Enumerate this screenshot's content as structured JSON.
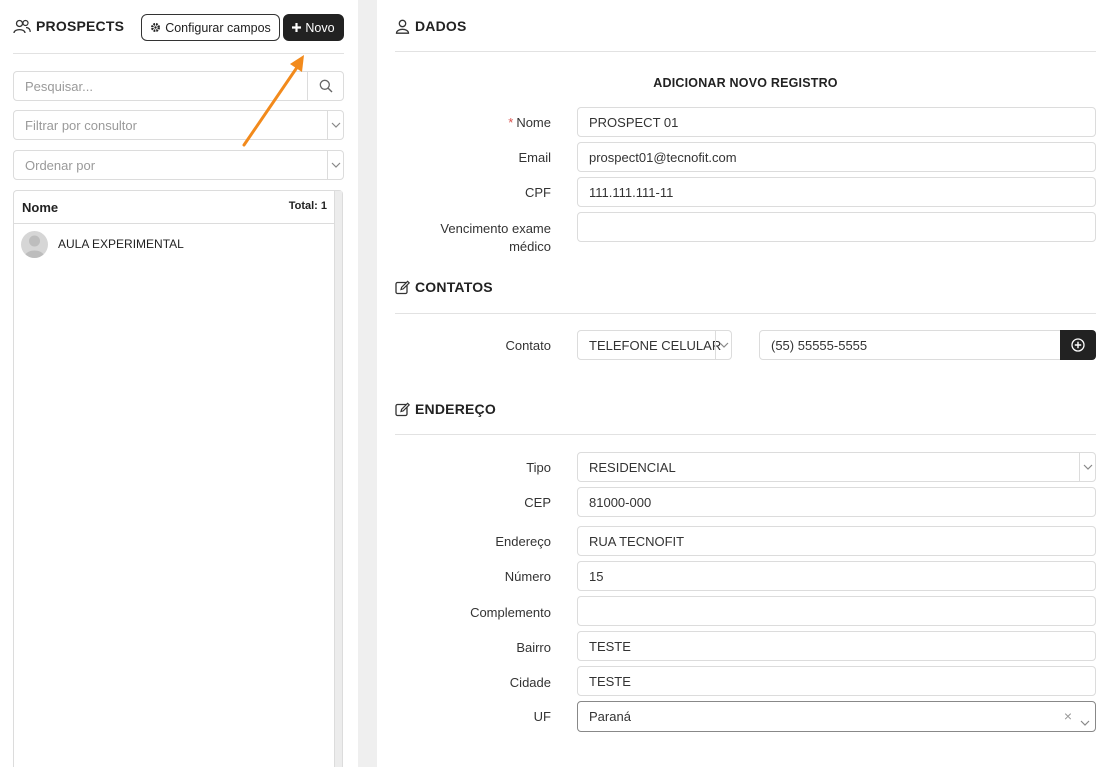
{
  "left": {
    "title": "PROSPECTS",
    "configure_label": "Configurar campos",
    "new_label": "Novo",
    "search": {
      "placeholder": "Pesquisar..."
    },
    "filter": {
      "placeholder": "Filtrar por consultor"
    },
    "order": {
      "placeholder": "Ordenar por"
    },
    "list": {
      "column": "Nome",
      "total": "Total: 1",
      "rows": [
        {
          "name": "AULA EXPERIMENTAL"
        }
      ]
    }
  },
  "right": {
    "dados_title": "DADOS",
    "form_title": "ADICIONAR NOVO REGISTRO",
    "fields": {
      "nome_label": "Nome",
      "nome_value": "PROSPECT 01",
      "email_label": "Email",
      "email_value": "prospect01@tecnofit.com",
      "cpf_label": "CPF",
      "cpf_value": "111.111.111-11",
      "vencimento_label_1": "Vencimento exame",
      "vencimento_label_2": "médico",
      "vencimento_value": ""
    },
    "contatos_title": "CONTATOS",
    "contato": {
      "label": "Contato",
      "type_value": "TELEFONE CELULAR",
      "phone_value": "(55) 55555-5555"
    },
    "endereco_title": "ENDEREÇO",
    "address": {
      "tipo_label": "Tipo",
      "tipo_value": "RESIDENCIAL",
      "cep_label": "CEP",
      "cep_value": "81000-000",
      "endereco_label": "Endereço",
      "endereco_value": "RUA TECNOFIT",
      "numero_label": "Número",
      "numero_value": "15",
      "complemento_label": "Complemento",
      "complemento_value": "",
      "bairro_label": "Bairro",
      "bairro_value": "TESTE",
      "cidade_label": "Cidade",
      "cidade_value": "TESTE",
      "uf_label": "UF",
      "uf_value": "Paraná",
      "uf_clear": "×"
    }
  },
  "colors": {
    "accent_arrow": "#f28a1c",
    "dark_button": "#222222",
    "required": "#d9534f"
  }
}
